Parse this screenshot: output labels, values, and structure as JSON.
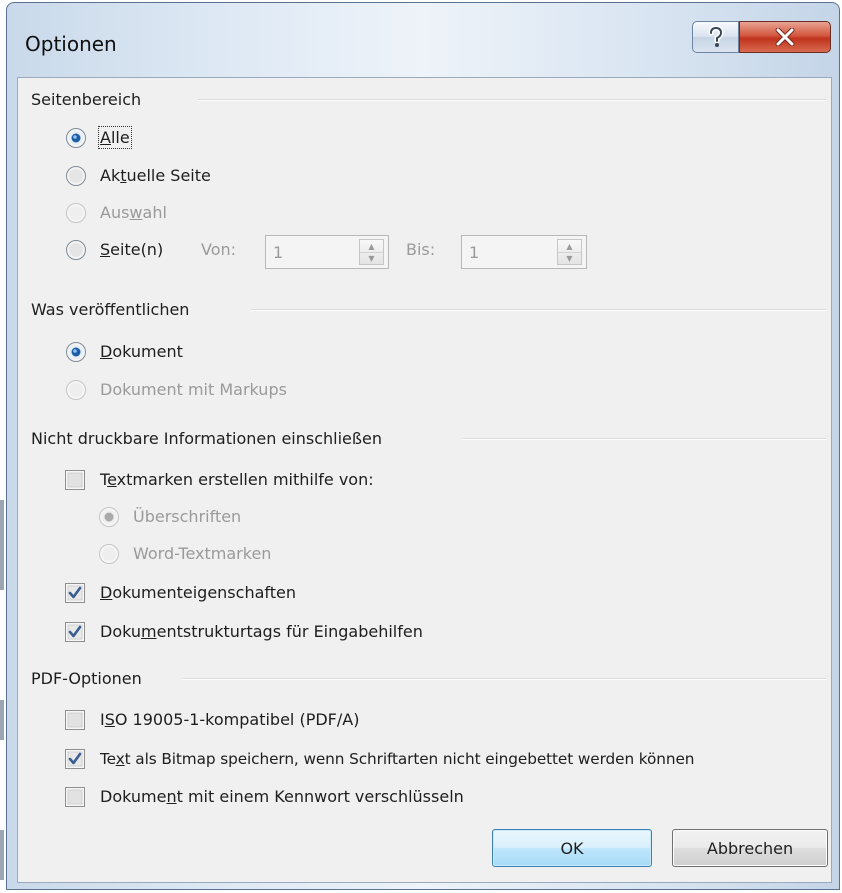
{
  "window": {
    "title": "Optionen",
    "help_glyph": "?",
    "close_glyph": "X"
  },
  "seitenbereich": {
    "heading": "Seitenbereich",
    "options": {
      "alle": {
        "pre": "",
        "key": "A",
        "post": "lle",
        "selected": true,
        "enabled": true
      },
      "aktuelle": {
        "pre": "Ak",
        "key": "t",
        "post": "uelle Seite",
        "selected": false,
        "enabled": true
      },
      "auswahl": {
        "pre": "Aus",
        "key": "w",
        "post": "ahl",
        "selected": false,
        "enabled": false
      },
      "seiten": {
        "pre": "",
        "key": "S",
        "post": "eite(n)",
        "selected": false,
        "enabled": true
      }
    },
    "von_label": "Von:",
    "von_value": "1",
    "bis_label": "Bis:",
    "bis_value": "1"
  },
  "veroeffentlichen": {
    "heading": "Was veröffentlichen",
    "dokument": {
      "pre": "",
      "key": "D",
      "post": "okument",
      "selected": true,
      "enabled": true
    },
    "markups": {
      "label": "Dokument mit Markups",
      "selected": false,
      "enabled": false
    }
  },
  "nicht_druckbar": {
    "heading": "Nicht druckbare Informationen einschließen",
    "textmarken": {
      "pre": "T",
      "key": "e",
      "post": "xtmarken erstellen mithilfe von:",
      "checked": false
    },
    "ueberschriften": {
      "label": "Überschriften",
      "selected": true,
      "enabled": false
    },
    "word_textmarken": {
      "label": "Word-Textmarken",
      "selected": false,
      "enabled": false
    },
    "eigenschaften": {
      "pre": "",
      "key": "D",
      "post": "okumenteigenschaften",
      "checked": true
    },
    "strukturtags": {
      "pre": "Doku",
      "key": "m",
      "post": "entstrukturtags für Eingabehilfen",
      "checked": true
    }
  },
  "pdf_optionen": {
    "heading": "PDF-Optionen",
    "iso": {
      "pre": "I",
      "key": "S",
      "post": "O 19005-1-kompatibel (PDF/A)",
      "checked": false
    },
    "bitmap": {
      "pre": "Te",
      "key": "x",
      "post": "t als Bitmap speichern, wenn Schriftarten nicht eingebettet werden können",
      "checked": true
    },
    "kennwort": {
      "pre": "Dokume",
      "key": "n",
      "post": "t mit einem Kennwort verschlüsseln",
      "checked": false
    }
  },
  "buttons": {
    "ok": "OK",
    "cancel": "Abbrechen"
  }
}
